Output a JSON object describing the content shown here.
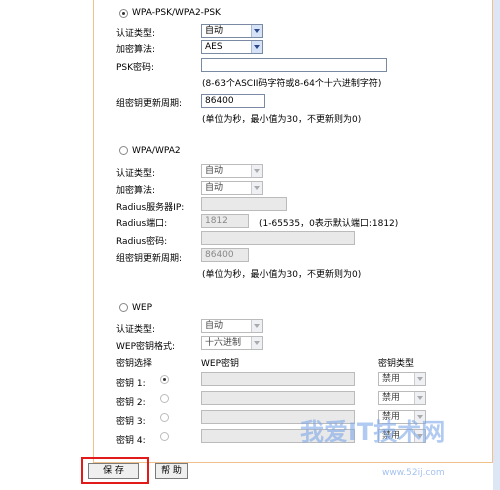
{
  "wpa_psk": {
    "title": "WPA-PSK/WPA2-PSK",
    "auth_label": "认证类型:",
    "auth_value": "自动",
    "enc_label": "加密算法:",
    "enc_value": "AES",
    "psk_label": "PSK密码:",
    "psk_hint": "(8-63个ASCII码字符或8-64个十六进制字符)",
    "period_label": "组密钥更新周期:",
    "period_value": "86400",
    "period_hint": "(单位为秒，最小值为30，不更新则为0)"
  },
  "wpa": {
    "title": "WPA/WPA2",
    "auth_label": "认证类型:",
    "auth_value": "自动",
    "enc_label": "加密算法:",
    "enc_value": "自动",
    "radius_ip_label": "Radius服务器IP:",
    "radius_port_label": "Radius端口:",
    "radius_port_value": "1812",
    "radius_port_hint": "(1-65535，0表示默认端口:1812)",
    "radius_pwd_label": "Radius密码:",
    "period_label": "组密钥更新周期:",
    "period_value": "86400",
    "period_hint": "(单位为秒，最小值为30，不更新则为0)"
  },
  "wep": {
    "title": "WEP",
    "auth_label": "认证类型:",
    "auth_value": "自动",
    "format_label": "WEP密钥格式:",
    "format_value": "十六进制",
    "col_select": "密钥选择",
    "col_key": "WEP密钥",
    "col_type": "密钥类型",
    "keys": [
      {
        "label": "密钥 1:",
        "type": "禁用"
      },
      {
        "label": "密钥 2:",
        "type": "禁用"
      },
      {
        "label": "密钥 3:",
        "type": "禁用"
      },
      {
        "label": "密钥 4:",
        "type": "禁用"
      }
    ]
  },
  "buttons": {
    "save": "保 存",
    "help": "帮 助"
  },
  "watermark": {
    "main": "我爱IT技术网",
    "url": "www.52ij.com"
  }
}
